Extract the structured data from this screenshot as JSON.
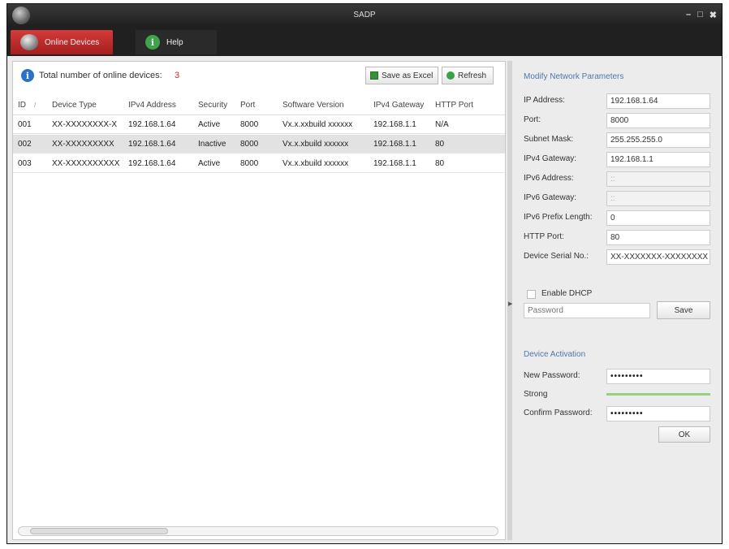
{
  "window": {
    "title": "SADP"
  },
  "tabs": [
    {
      "label": "Online Devices"
    },
    {
      "label": "Help"
    }
  ],
  "toolbar": {
    "total_label": "Total number of online devices:",
    "total_count": "3",
    "save_excel_label": "Save as Excel",
    "refresh_label": "Refresh"
  },
  "table": {
    "columns": [
      "ID",
      "Device Type",
      "IPv4 Address",
      "Security",
      "Port",
      "Software Version",
      "IPv4 Gateway",
      "HTTP Port"
    ],
    "rows": [
      [
        "001",
        "XX-XXXXXXXX-X",
        "192.168.1.64",
        "Active",
        "8000",
        "Vx.x.xxbuild xxxxxx",
        "192.168.1.1",
        "N/A"
      ],
      [
        "002",
        "XX-XXXXXXXXX",
        "192.168.1.64",
        "Inactive",
        "8000",
        "Vx.x.xbuild xxxxxx",
        "192.168.1.1",
        "80"
      ],
      [
        "003",
        "XX-XXXXXXXXXX",
        "192.168.1.64",
        "Active",
        "8000",
        "Vx.x.xbuild xxxxxx",
        "192.168.1.1",
        "80"
      ]
    ],
    "selected_row": 2
  },
  "modify": {
    "title": "Modify Network Parameters",
    "fields": [
      {
        "label": "IP Address:",
        "value": "192.168.1.64",
        "disabled": false
      },
      {
        "label": "Port:",
        "value": "8000",
        "disabled": false
      },
      {
        "label": "Subnet Mask:",
        "value": "255.255.255.0",
        "disabled": false
      },
      {
        "label": "IPv4 Gateway:",
        "value": "192.168.1.1",
        "disabled": false
      },
      {
        "label": "IPv6 Address:",
        "value": "::",
        "disabled": true
      },
      {
        "label": "IPv6 Gateway:",
        "value": "::",
        "disabled": true
      },
      {
        "label": "IPv6 Prefix Length:",
        "value": "0",
        "disabled": false
      },
      {
        "label": "HTTP Port:",
        "value": "80",
        "disabled": false
      },
      {
        "label": "Device Serial No.:",
        "value": "XX-XXXXXXX-XXXXXXXX",
        "disabled": false
      }
    ],
    "dhcp_label": "Enable DHCP",
    "dhcp_checked": false,
    "password_placeholder": "Password",
    "save_label": "Save"
  },
  "activation": {
    "title": "Device Activation",
    "new_password_label": "New Password:",
    "new_password_value": "•••••••••",
    "strength_label": "Strong",
    "confirm_label": "Confirm Password:",
    "confirm_value": "•••••••••",
    "ok_label": "OK"
  },
  "colors": {
    "accent_tab": "#c62828",
    "section_title": "#4a78b0",
    "strength": "#9bd07a"
  },
  "icons": {
    "app": "sadp-logo-icon",
    "online_devices": "devices-icon",
    "help": "help-icon",
    "info": "info-icon",
    "excel": "excel-icon",
    "refresh": "refresh-icon"
  }
}
